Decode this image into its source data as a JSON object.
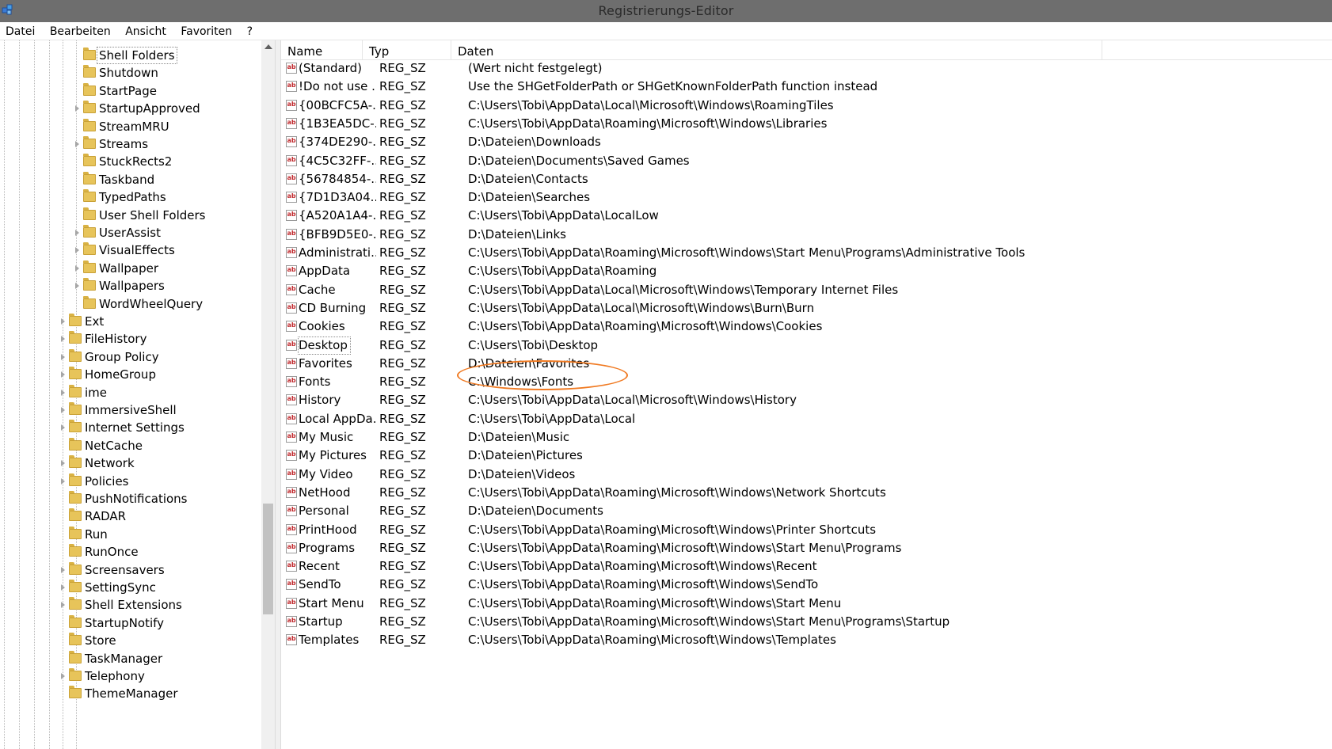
{
  "window": {
    "title": "Registrierungs-Editor",
    "app_icon": "regedit-icon"
  },
  "menu": [
    "Datei",
    "Bearbeiten",
    "Ansicht",
    "Favoriten",
    "?"
  ],
  "tree": {
    "level_deep": [
      {
        "label": "Shell Folders",
        "expandable": false,
        "selected": true
      },
      {
        "label": "Shutdown",
        "expandable": false
      },
      {
        "label": "StartPage",
        "expandable": false
      },
      {
        "label": "StartupApproved",
        "expandable": true
      },
      {
        "label": "StreamMRU",
        "expandable": false
      },
      {
        "label": "Streams",
        "expandable": true
      },
      {
        "label": "StuckRects2",
        "expandable": false
      },
      {
        "label": "Taskband",
        "expandable": false
      },
      {
        "label": "TypedPaths",
        "expandable": false
      },
      {
        "label": "User Shell Folders",
        "expandable": false
      },
      {
        "label": "UserAssist",
        "expandable": true
      },
      {
        "label": "VisualEffects",
        "expandable": true
      },
      {
        "label": "Wallpaper",
        "expandable": true
      },
      {
        "label": "Wallpapers",
        "expandable": true
      },
      {
        "label": "WordWheelQuery",
        "expandable": false
      }
    ],
    "level_mid": [
      {
        "label": "Ext",
        "expandable": true
      },
      {
        "label": "FileHistory",
        "expandable": true
      },
      {
        "label": "Group Policy",
        "expandable": true
      },
      {
        "label": "HomeGroup",
        "expandable": true
      },
      {
        "label": "ime",
        "expandable": true
      },
      {
        "label": "ImmersiveShell",
        "expandable": true
      },
      {
        "label": "Internet Settings",
        "expandable": true
      },
      {
        "label": "NetCache",
        "expandable": false
      },
      {
        "label": "Network",
        "expandable": true
      },
      {
        "label": "Policies",
        "expandable": true
      },
      {
        "label": "PushNotifications",
        "expandable": false
      },
      {
        "label": "RADAR",
        "expandable": false
      },
      {
        "label": "Run",
        "expandable": false
      },
      {
        "label": "RunOnce",
        "expandable": false
      },
      {
        "label": "Screensavers",
        "expandable": true
      },
      {
        "label": "SettingSync",
        "expandable": true
      },
      {
        "label": "Shell Extensions",
        "expandable": true
      },
      {
        "label": "StartupNotify",
        "expandable": false
      },
      {
        "label": "Store",
        "expandable": false
      },
      {
        "label": "TaskManager",
        "expandable": false
      },
      {
        "label": "Telephony",
        "expandable": true
      },
      {
        "label": "ThemeManager",
        "expandable": false
      }
    ]
  },
  "list": {
    "columns": {
      "name": "Name",
      "type": "Typ",
      "data": "Daten"
    },
    "rows": [
      {
        "name": "(Standard)",
        "type": "REG_SZ",
        "data": "(Wert nicht festgelegt)"
      },
      {
        "name": "!Do not use ...",
        "type": "REG_SZ",
        "data": "Use the SHGetFolderPath or SHGetKnownFolderPath function instead"
      },
      {
        "name": "{00BCFC5A-...",
        "type": "REG_SZ",
        "data": "C:\\Users\\Tobi\\AppData\\Local\\Microsoft\\Windows\\RoamingTiles"
      },
      {
        "name": "{1B3EA5DC-...",
        "type": "REG_SZ",
        "data": "C:\\Users\\Tobi\\AppData\\Roaming\\Microsoft\\Windows\\Libraries"
      },
      {
        "name": "{374DE290-...",
        "type": "REG_SZ",
        "data": "D:\\Dateien\\Downloads"
      },
      {
        "name": "{4C5C32FF-...",
        "type": "REG_SZ",
        "data": "D:\\Dateien\\Documents\\Saved Games"
      },
      {
        "name": "{56784854-...",
        "type": "REG_SZ",
        "data": "D:\\Dateien\\Contacts"
      },
      {
        "name": "{7D1D3A04...",
        "type": "REG_SZ",
        "data": "D:\\Dateien\\Searches"
      },
      {
        "name": "{A520A1A4-...",
        "type": "REG_SZ",
        "data": "C:\\Users\\Tobi\\AppData\\LocalLow"
      },
      {
        "name": "{BFB9D5E0-...",
        "type": "REG_SZ",
        "data": "D:\\Dateien\\Links"
      },
      {
        "name": "Administrati...",
        "type": "REG_SZ",
        "data": "C:\\Users\\Tobi\\AppData\\Roaming\\Microsoft\\Windows\\Start Menu\\Programs\\Administrative Tools"
      },
      {
        "name": "AppData",
        "type": "REG_SZ",
        "data": "C:\\Users\\Tobi\\AppData\\Roaming"
      },
      {
        "name": "Cache",
        "type": "REG_SZ",
        "data": "C:\\Users\\Tobi\\AppData\\Local\\Microsoft\\Windows\\Temporary Internet Files"
      },
      {
        "name": "CD Burning",
        "type": "REG_SZ",
        "data": "C:\\Users\\Tobi\\AppData\\Local\\Microsoft\\Windows\\Burn\\Burn"
      },
      {
        "name": "Cookies",
        "type": "REG_SZ",
        "data": "C:\\Users\\Tobi\\AppData\\Roaming\\Microsoft\\Windows\\Cookies"
      },
      {
        "name": "Desktop",
        "type": "REG_SZ",
        "data": "C:\\Users\\Tobi\\Desktop",
        "selected": true
      },
      {
        "name": "Favorites",
        "type": "REG_SZ",
        "data": "D:\\Dateien\\Favorites"
      },
      {
        "name": "Fonts",
        "type": "REG_SZ",
        "data": "C:\\Windows\\Fonts"
      },
      {
        "name": "History",
        "type": "REG_SZ",
        "data": "C:\\Users\\Tobi\\AppData\\Local\\Microsoft\\Windows\\History"
      },
      {
        "name": "Local AppDa...",
        "type": "REG_SZ",
        "data": "C:\\Users\\Tobi\\AppData\\Local"
      },
      {
        "name": "My Music",
        "type": "REG_SZ",
        "data": "D:\\Dateien\\Music"
      },
      {
        "name": "My Pictures",
        "type": "REG_SZ",
        "data": "D:\\Dateien\\Pictures"
      },
      {
        "name": "My Video",
        "type": "REG_SZ",
        "data": "D:\\Dateien\\Videos"
      },
      {
        "name": "NetHood",
        "type": "REG_SZ",
        "data": "C:\\Users\\Tobi\\AppData\\Roaming\\Microsoft\\Windows\\Network Shortcuts"
      },
      {
        "name": "Personal",
        "type": "REG_SZ",
        "data": "D:\\Dateien\\Documents"
      },
      {
        "name": "PrintHood",
        "type": "REG_SZ",
        "data": "C:\\Users\\Tobi\\AppData\\Roaming\\Microsoft\\Windows\\Printer Shortcuts"
      },
      {
        "name": "Programs",
        "type": "REG_SZ",
        "data": "C:\\Users\\Tobi\\AppData\\Roaming\\Microsoft\\Windows\\Start Menu\\Programs"
      },
      {
        "name": "Recent",
        "type": "REG_SZ",
        "data": "C:\\Users\\Tobi\\AppData\\Roaming\\Microsoft\\Windows\\Recent"
      },
      {
        "name": "SendTo",
        "type": "REG_SZ",
        "data": "C:\\Users\\Tobi\\AppData\\Roaming\\Microsoft\\Windows\\SendTo"
      },
      {
        "name": "Start Menu",
        "type": "REG_SZ",
        "data": "C:\\Users\\Tobi\\AppData\\Roaming\\Microsoft\\Windows\\Start Menu"
      },
      {
        "name": "Startup",
        "type": "REG_SZ",
        "data": "C:\\Users\\Tobi\\AppData\\Roaming\\Microsoft\\Windows\\Start Menu\\Programs\\Startup"
      },
      {
        "name": "Templates",
        "type": "REG_SZ",
        "data": "C:\\Users\\Tobi\\AppData\\Roaming\\Microsoft\\Windows\\Templates"
      }
    ]
  },
  "string_value_icon": {
    "icon": "reg-sz-icon",
    "glyph": "ab"
  },
  "colors": {
    "annotation": "#f07a22",
    "folder": "#e7c45a"
  }
}
